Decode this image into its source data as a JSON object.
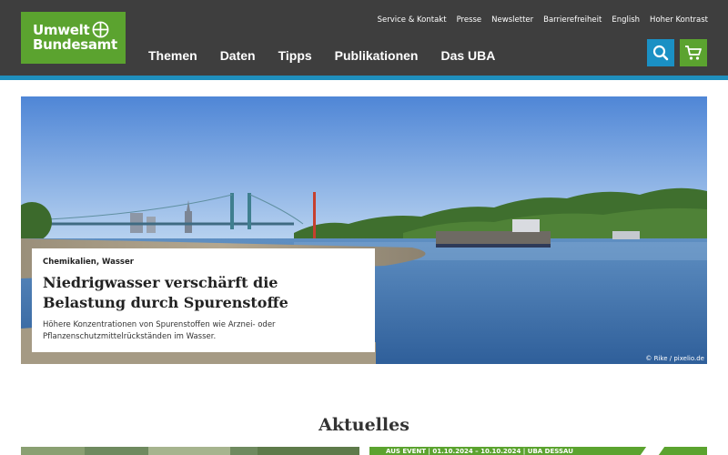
{
  "logo": {
    "line1": "Umwelt",
    "line2": "Bundesamt"
  },
  "service_nav": [
    "Service & Kontakt",
    "Presse",
    "Newsletter",
    "Barrierefreiheit",
    "English",
    "Hoher Kontrast"
  ],
  "main_nav": [
    "Themen",
    "Daten",
    "Tipps",
    "Publikationen",
    "Das UBA"
  ],
  "icons": {
    "search": "search-icon",
    "cart": "cart-icon"
  },
  "hero": {
    "tags": "Chemikalien, Wasser",
    "title": "Niedrigwasser verschärft die Belastung durch Spurenstoffe",
    "text": "Höhere Konzentrationen von Spurenstoffen wie Arznei- oder Pflanzenschutzmittelrück­ständen im Wasser.",
    "credit": "© Rike / pixelio.de"
  },
  "section_title": "Aktuelles",
  "teaser_right_text": "AUS EVENT | 01.10.2024 – 10.10.2024 | UBA DESSAU",
  "colors": {
    "header": "#3e3e3e",
    "accent_green": "#5ba32f",
    "accent_blue": "#1a90c4"
  }
}
